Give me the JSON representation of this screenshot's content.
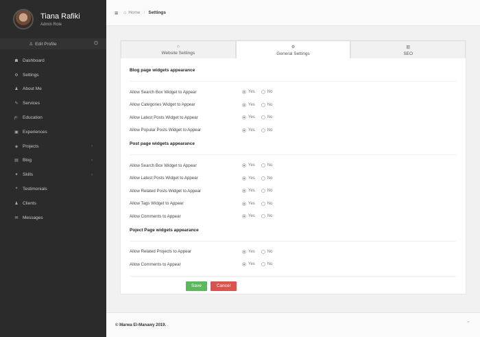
{
  "profile": {
    "name": "Tiana Rafiki",
    "role": "Admin Role",
    "edit_label": "Edit Profile"
  },
  "sidebar": {
    "items": [
      {
        "label": "Dashboard",
        "icon": "☗",
        "chevron": ""
      },
      {
        "label": "Settings",
        "icon": "⚙",
        "chevron": ""
      },
      {
        "label": "About Me",
        "icon": "♟",
        "chevron": ""
      },
      {
        "label": "Services",
        "icon": "✎",
        "chevron": ""
      },
      {
        "label": "Education",
        "icon": "🎓",
        "chevron": ""
      },
      {
        "label": "Experiences",
        "icon": "▣",
        "chevron": ""
      },
      {
        "label": "Projects",
        "icon": "◈",
        "chevron": "›"
      },
      {
        "label": "Blog",
        "icon": "▤",
        "chevron": "›"
      },
      {
        "label": "Skills",
        "icon": "✦",
        "chevron": "›"
      },
      {
        "label": "Testimonials",
        "icon": "❝",
        "chevron": ""
      },
      {
        "label": "Clients",
        "icon": "♟",
        "chevron": ""
      },
      {
        "label": "Messages",
        "icon": "✉",
        "chevron": ""
      }
    ]
  },
  "header": {
    "hamburger": "≡",
    "breadcrumb": {
      "home": "Home",
      "sep": "/",
      "current": "Settings"
    }
  },
  "tabs": [
    {
      "label": "Website Settings",
      "icon": "⌂"
    },
    {
      "label": "General Settings",
      "icon": "⚙"
    },
    {
      "label": "SEO",
      "icon": "▥"
    }
  ],
  "radio_labels": {
    "yes": "Yes",
    "no": "No"
  },
  "sections": [
    {
      "title": "Blog page widgets appearance",
      "options": [
        "Allow Search Box Widget to Appear",
        "Allow Categories Widget to Appear",
        "Allow Latest Posts Widget to Appear",
        "Allow Popular Posts Widget to Appear"
      ]
    },
    {
      "title": "Post page widgets appearance",
      "options": [
        "Allow Search Box Widget to Appear",
        "Allow Latest Posts Widget to Appear",
        "Allow Related Posts Widget to Appear",
        "Allow Tags Widget to Appear",
        "Allow Comments to Appear"
      ]
    },
    {
      "title": "Poject Page widgets appearance",
      "options": [
        "Allow Related Projects to Appear",
        "Allow Comments to Appear"
      ]
    }
  ],
  "buttons": {
    "save": "Save",
    "cancel": "Cancel"
  },
  "footer": {
    "text": "© Marwa El-Manawy 2019.",
    "scroll_top": "⌃"
  },
  "colors": {
    "sidebar": "#2b2b2b",
    "save": "#5cb85c",
    "cancel": "#d9534f"
  }
}
